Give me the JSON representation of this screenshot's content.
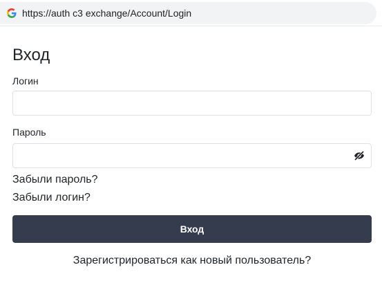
{
  "browser": {
    "url": "https://auth c3 exchange/Account/Login",
    "favicon": "google-g-icon"
  },
  "login_form": {
    "title": "Вход",
    "login_label": "Логин",
    "login_value": "",
    "password_label": "Пароль",
    "password_value": "",
    "password_toggle_icon": "eye-slash-icon",
    "forgot_password": "Забыли пароль?",
    "forgot_login": "Забыли логин?",
    "submit_label": "Вход",
    "register_link": "Зарегистрироваться как новый пользователь?"
  },
  "colors": {
    "button_bg": "#343c4e",
    "button_text": "#ffffff",
    "text": "#212529",
    "input_border": "#dee2e6",
    "address_bar_bg": "#f1f3f4"
  }
}
